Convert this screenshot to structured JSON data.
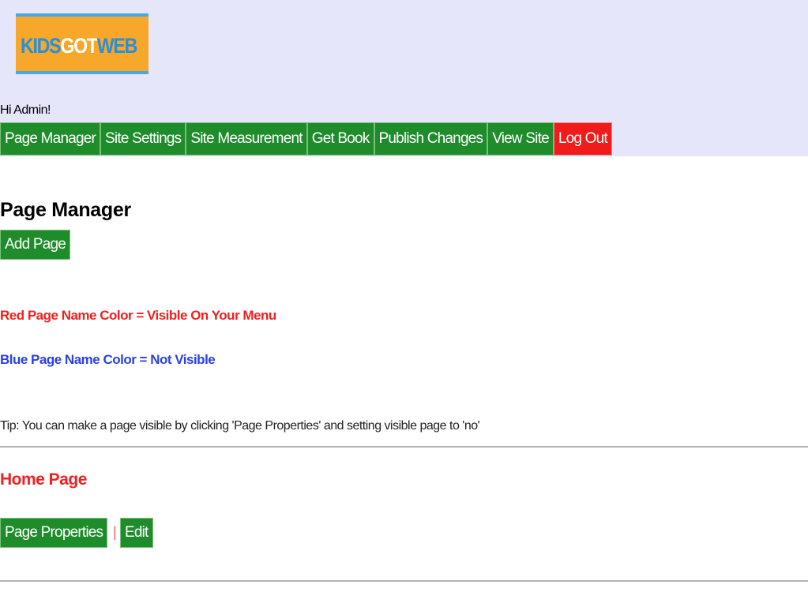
{
  "logo": {
    "part1": "KIDS",
    "part2": "GOT",
    "part3": "WEB"
  },
  "greeting": "Hi Admin!",
  "nav": {
    "items": [
      "Page Manager",
      "Site Settings",
      "Site Measurement",
      "Get Book",
      "Publish Changes",
      "View Site",
      "Log Out"
    ]
  },
  "main": {
    "title": "Page Manager",
    "add_page_label": "Add Page",
    "legend_red": "Red Page Name Color = Visible On Your Menu",
    "legend_blue": "Blue Page Name Color = Not Visible",
    "tip": "Tip: You can make a page visible by clicking 'Page Properties' and setting visible page to 'no'"
  },
  "pages": [
    {
      "name": "Home Page",
      "properties_label": "Page Properties",
      "separator": "|",
      "edit_label": "Edit"
    }
  ],
  "colors": {
    "header_bg": "#e6e6fa",
    "button_green": "#1e8c2a",
    "logout_red": "#f01c1c",
    "visible_red": "#f02020",
    "not_visible_blue": "#2a40e6",
    "logo_orange": "#f7a72a",
    "logo_blue": "#2a8fd6"
  }
}
